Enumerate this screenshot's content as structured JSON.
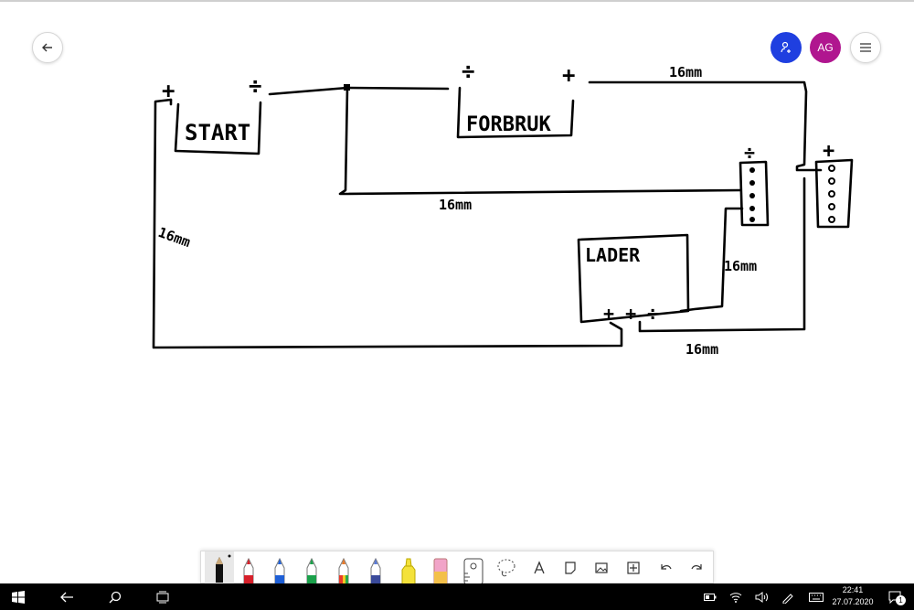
{
  "header": {
    "back_icon": "arrow-left-icon",
    "invite_icon": "person-add-icon",
    "avatar_initials": "AG",
    "menu_icon": "hamburger-icon",
    "colors": {
      "invite_bg": "#1f3fe0",
      "avatar_bg": "#b0168f"
    }
  },
  "drawing": {
    "start_label": "START",
    "forbruk_label": "FORBRUK",
    "lader_label": "LADER",
    "plus": "+",
    "minus": "÷",
    "charger_terminals": "+ + ÷",
    "wire_labels": [
      "16mm",
      "16mm",
      "16mm",
      "16mm",
      "16mm"
    ],
    "ink_color": "#000000"
  },
  "toolbar": {
    "tools": [
      "pencil",
      "red-pen",
      "blue-pen",
      "green-pen",
      "rainbow-pen",
      "galaxy-pen",
      "highlighter",
      "eraser",
      "ruler",
      "lasso",
      "text",
      "note",
      "image",
      "add",
      "undo",
      "redo"
    ],
    "pen_colors": {
      "red": "#d6202a",
      "blue": "#1e5fd6",
      "green": "#1aa04a",
      "highlighter": "#f4e23a",
      "eraser": "#f1a4c8"
    }
  },
  "taskbar": {
    "icons": [
      "windows-start-icon",
      "back-arrow-icon",
      "search-icon",
      "task-view-icon"
    ],
    "tray_icons": [
      "battery-icon",
      "wifi-icon",
      "volume-icon",
      "keyboard-icon",
      "pen-icon"
    ],
    "time": "22:41",
    "date": "27.07.2020",
    "notification_count": "1"
  }
}
